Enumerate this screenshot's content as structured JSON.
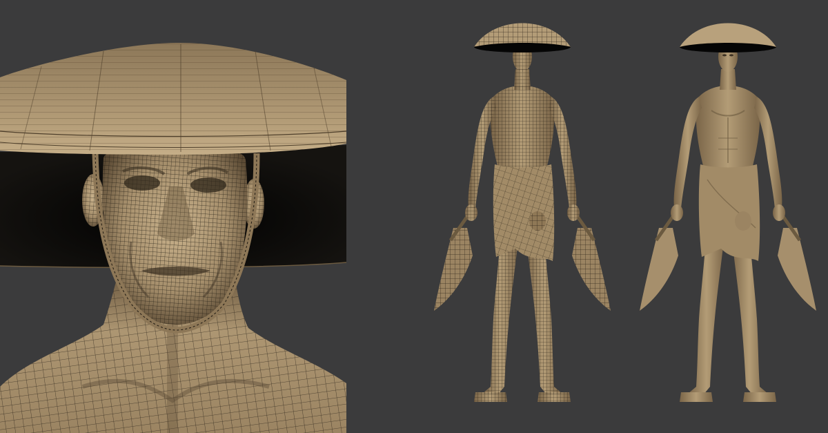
{
  "viewport": {
    "background": "#3b3b3c",
    "views": [
      {
        "name": "head-closeup-wireframe",
        "mode": "wireframe"
      },
      {
        "name": "full-body-wireframe",
        "mode": "wireframe"
      },
      {
        "name": "full-body-shaded",
        "mode": "shaded"
      }
    ]
  },
  "colors": {
    "clay": "#a68f6c",
    "clay_dark": "#5b4a34",
    "clay_light": "#c7b08a",
    "wire": "#1e1912",
    "hat_shadow": "#050505"
  }
}
